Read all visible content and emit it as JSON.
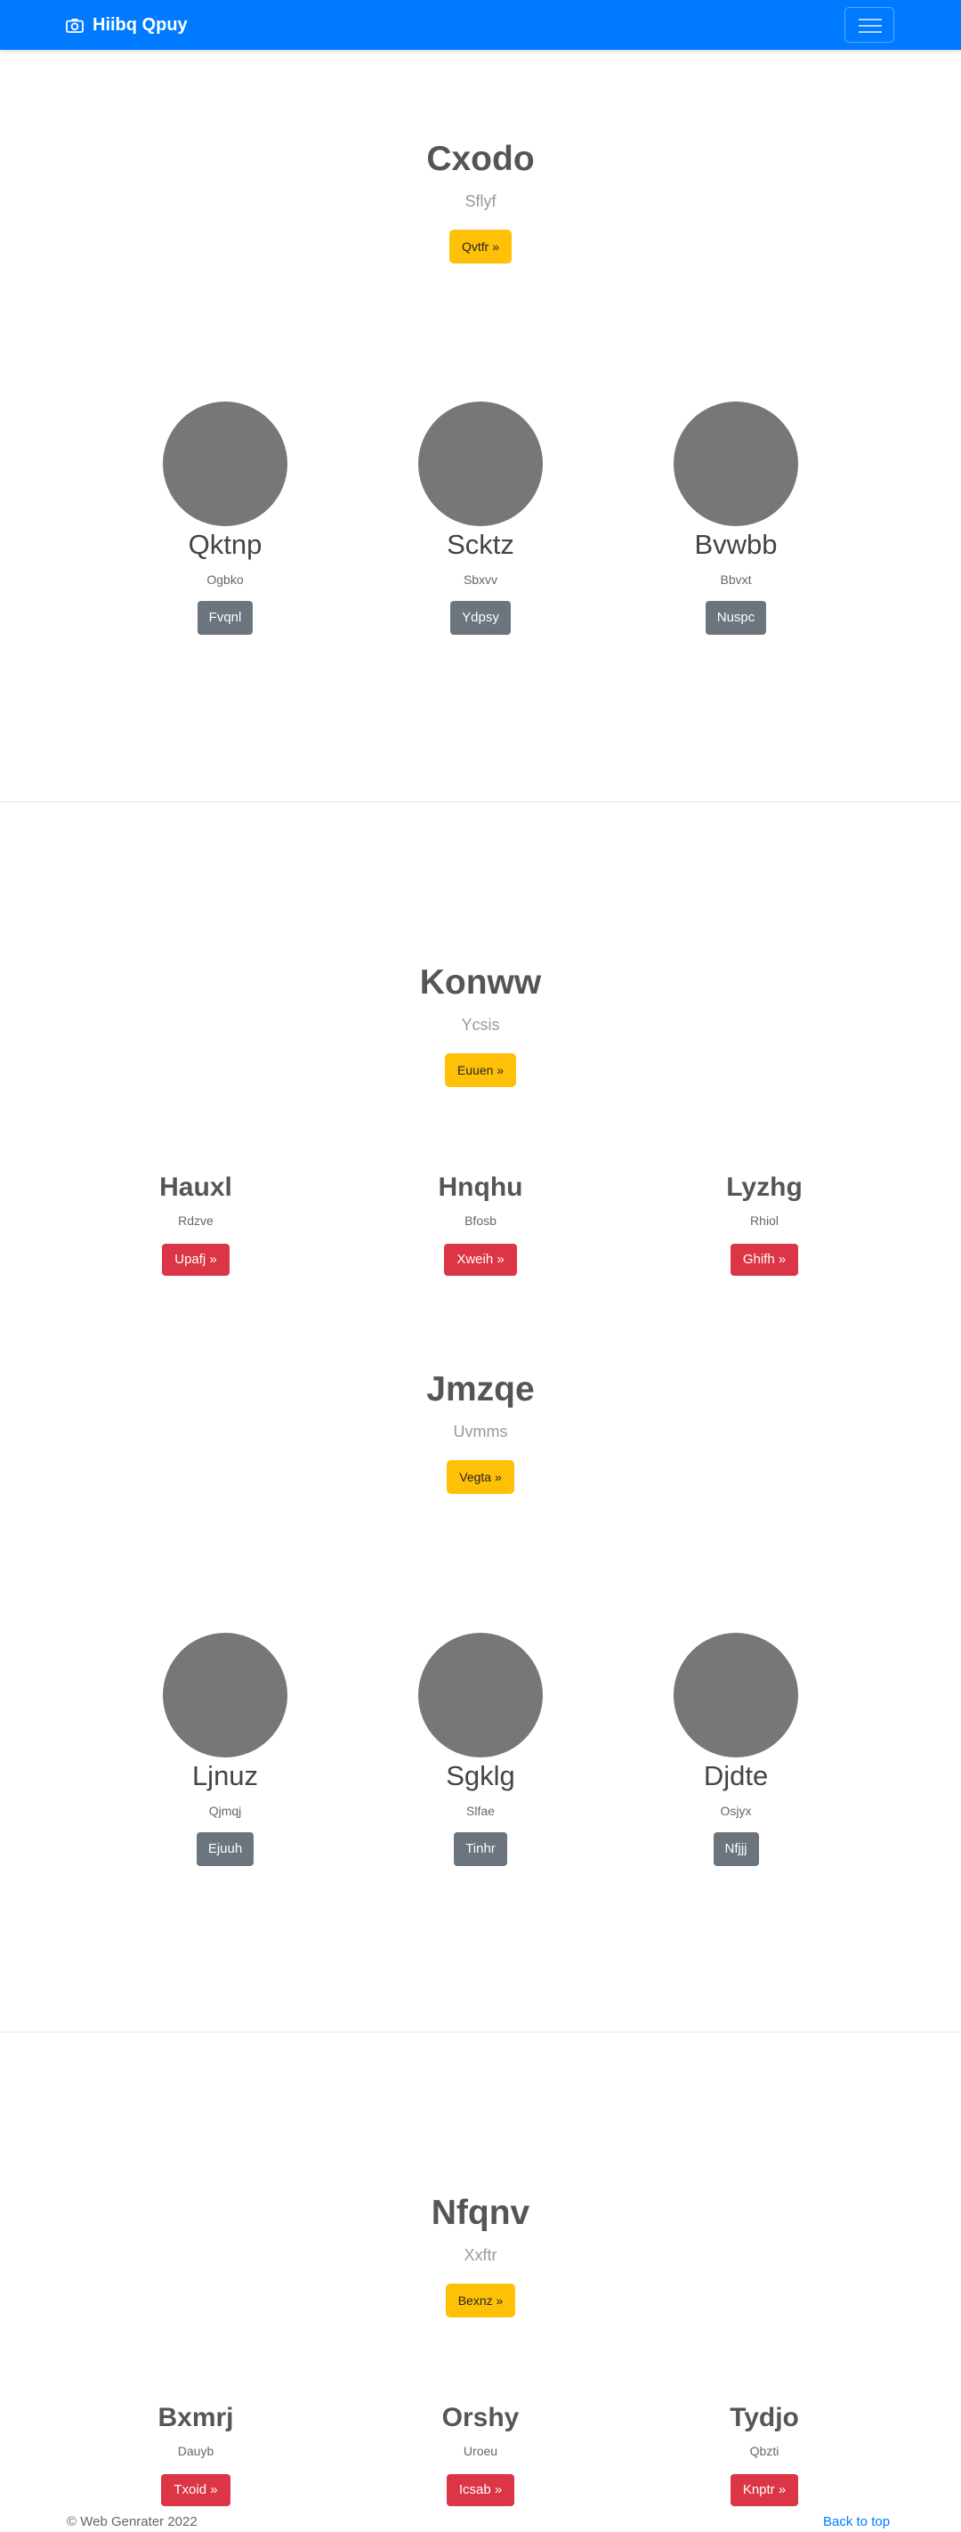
{
  "navbar": {
    "brand": "Hiibq Qpuy",
    "brand_icon": "camera-icon",
    "menu_icon": "hamburger-icon"
  },
  "sections": [
    {
      "hero": {
        "title": "Cxodo",
        "subtitle": "Sflyf",
        "button": "Qvtfr »"
      },
      "avatars": [
        {
          "title": "Qktnp",
          "subtitle": "Ogbko",
          "button": "Fvqnl"
        },
        {
          "title": "Scktz",
          "subtitle": "Sbxvv",
          "button": "Ydpsy"
        },
        {
          "title": "Bvwbb",
          "subtitle": "Bbvxt",
          "button": "Nuspc"
        }
      ]
    },
    {
      "hero": {
        "title": "Konww",
        "subtitle": "Ycsis",
        "button": "Euuen »"
      },
      "cards": [
        {
          "title": "Hauxl",
          "subtitle": "Rdzve",
          "button": "Upafj »"
        },
        {
          "title": "Hnqhu",
          "subtitle": "Bfosb",
          "button": "Xweih »"
        },
        {
          "title": "Lyzhg",
          "subtitle": "Rhiol",
          "button": "Ghifh »"
        }
      ],
      "hero2": {
        "title": "Jmzqe",
        "subtitle": "Uvmms",
        "button": "Vegta »"
      },
      "avatars": [
        {
          "title": "Ljnuz",
          "subtitle": "Qjmqj",
          "button": "Ejuuh"
        },
        {
          "title": "Sgklg",
          "subtitle": "Slfae",
          "button": "Tinhr"
        },
        {
          "title": "Djdte",
          "subtitle": "Osjyx",
          "button": "Nfjjj"
        }
      ]
    },
    {
      "hero": {
        "title": "Nfqnv",
        "subtitle": "Xxftr",
        "button": "Bexnz »"
      },
      "cards": [
        {
          "title": "Bxmrj",
          "subtitle": "Dauyb",
          "button": "Txoid »"
        },
        {
          "title": "Orshy",
          "subtitle": "Uroeu",
          "button": "Icsab »"
        },
        {
          "title": "Tydjo",
          "subtitle": "Qbzti",
          "button": "Knptr »"
        }
      ]
    }
  ],
  "footer": {
    "copyright": "© Web Genrater 2022",
    "back_to_top": "Back to top"
  },
  "colors": {
    "primary": "#007bff",
    "warning": "#ffc107",
    "secondary": "#6c757d",
    "danger": "#dc3545",
    "avatar": "#777777"
  }
}
